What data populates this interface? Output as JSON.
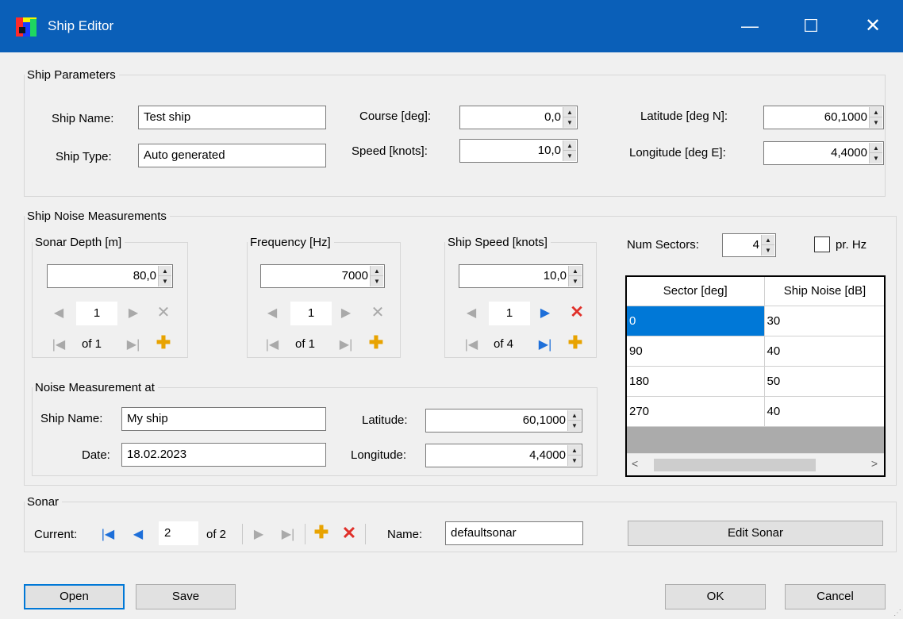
{
  "window": {
    "title": "Ship Editor"
  },
  "ship_parameters": {
    "group_title": "Ship Parameters",
    "ship_name_label": "Ship Name:",
    "ship_name_value": "Test ship",
    "ship_type_label": "Ship Type:",
    "ship_type_value": "Auto generated",
    "course_label": "Course [deg]:",
    "course_value": "0,0",
    "speed_label": "Speed [knots]:",
    "speed_value": "10,0",
    "latitude_label": "Latitude [deg N]:",
    "latitude_value": "60,1000",
    "longitude_label": "Longitude [deg E]:",
    "longitude_value": "4,4000"
  },
  "noise": {
    "group_title": "Ship Noise Measurements",
    "sonar_depth": {
      "title": "Sonar Depth [m]",
      "value": "80,0",
      "position": "1",
      "of": "of 1"
    },
    "frequency": {
      "title": "Frequency [Hz]",
      "value": "7000",
      "position": "1",
      "of": "of 1"
    },
    "ship_speed": {
      "title": "Ship Speed [knots]",
      "value": "10,0",
      "position": "1",
      "of": "of 4"
    },
    "num_sectors_label": "Num Sectors:",
    "num_sectors_value": "4",
    "pr_hz_label": "pr. Hz",
    "table": {
      "headers": [
        "Sector [deg]",
        "Ship Noise [dB]"
      ],
      "rows": [
        [
          "0",
          "30"
        ],
        [
          "90",
          "40"
        ],
        [
          "180",
          "50"
        ],
        [
          "270",
          "40"
        ]
      ]
    },
    "measurement": {
      "group_title": "Noise Measurement at",
      "ship_name_label": "Ship Name:",
      "ship_name_value": "My ship",
      "date_label": "Date:",
      "date_value": "18.02.2023",
      "latitude_label": "Latitude:",
      "latitude_value": "60,1000",
      "longitude_label": "Longitude:",
      "longitude_value": "4,4000"
    }
  },
  "sonar": {
    "group_title": "Sonar",
    "current_label": "Current:",
    "position": "2",
    "of": "of 2",
    "name_label": "Name:",
    "name_value": "defaultsonar",
    "edit_button": "Edit Sonar"
  },
  "buttons": {
    "open": "Open",
    "save": "Save",
    "ok": "OK",
    "cancel": "Cancel"
  },
  "icons": {
    "minimize": "—",
    "maximize": "☐",
    "close": "✕",
    "first": "|◀",
    "prev": "◀",
    "next": "▶",
    "last": "▶|",
    "delete": "✕",
    "add": "✚",
    "spin_up": "▲",
    "spin_down": "▼",
    "scroll_left": "<",
    "scroll_right": ">"
  },
  "colors": {
    "titlebar": "#0a5fb8",
    "selection": "#0078d7",
    "nav_active": "#1e6fd9",
    "delete_active": "#e0302a",
    "add": "#e8a300"
  }
}
